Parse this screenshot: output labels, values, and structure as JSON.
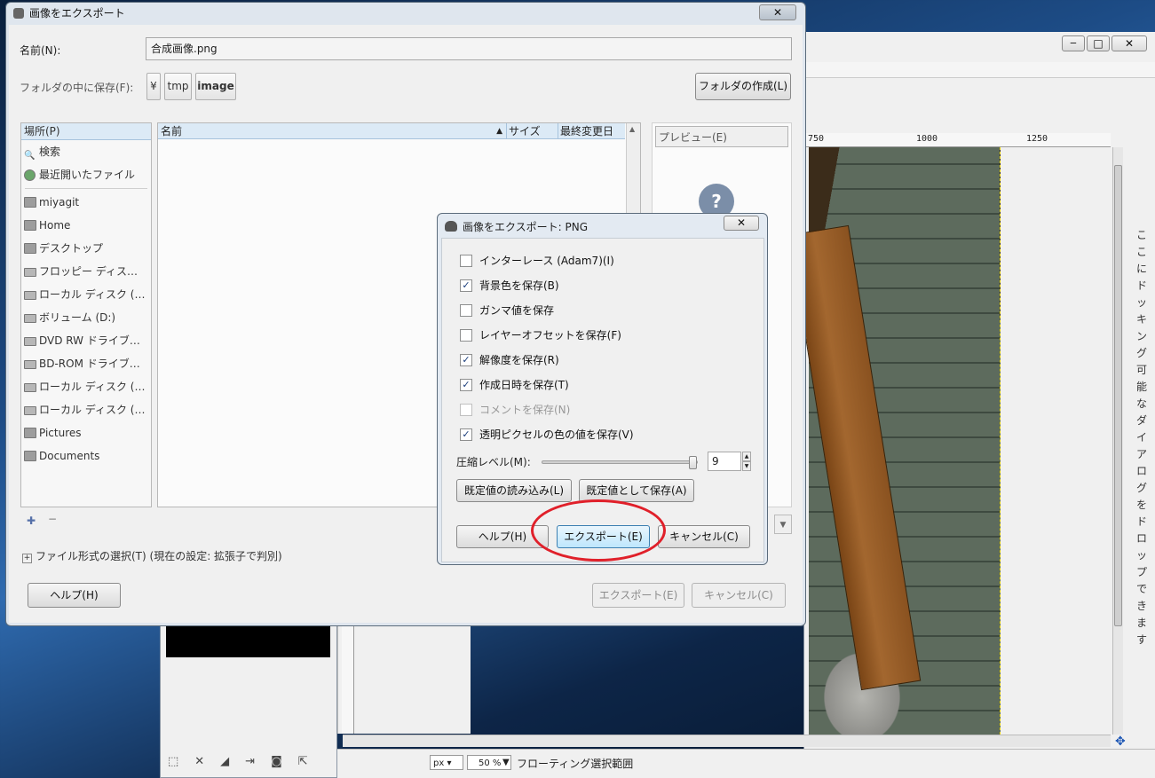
{
  "export_dialog": {
    "title": "画像をエクスポート",
    "name_label": "名前(N):",
    "name_value": "合成画像.png",
    "folder_label": "フォルダの中に保存(F):",
    "path_segments": [
      "¥",
      "tmp",
      "image"
    ],
    "create_folder_label": "フォルダの作成(L)",
    "places_header": "場所(P)",
    "places": [
      {
        "label": "検索",
        "icon": "search-icon"
      },
      {
        "label": "最近開いたファイル",
        "icon": "recent-icon"
      },
      {
        "label": "miyagit",
        "icon": "folder-icon"
      },
      {
        "label": "Home",
        "icon": "folder-icon"
      },
      {
        "label": "デスクトップ",
        "icon": "folder-icon"
      },
      {
        "label": "フロッピー ディス…",
        "icon": "drive-icon"
      },
      {
        "label": "ローカル ディスク (…",
        "icon": "drive-icon"
      },
      {
        "label": "ボリューム (D:)",
        "icon": "drive-icon"
      },
      {
        "label": "DVD RW ドライブ…",
        "icon": "drive-icon"
      },
      {
        "label": "BD-ROM ドライブ…",
        "icon": "drive-icon"
      },
      {
        "label": "ローカル ディスク (…",
        "icon": "drive-icon"
      },
      {
        "label": "ローカル ディスク (…",
        "icon": "drive-icon"
      },
      {
        "label": "Pictures",
        "icon": "folder-icon"
      },
      {
        "label": "Documents",
        "icon": "folder-icon"
      }
    ],
    "columns": {
      "name": "名前",
      "size": "サイズ",
      "modified": "最終変更日"
    },
    "preview_label": "プレビュー(E)",
    "file_type_label": "ファイル形式の選択(T) (現在の設定: 拡張子で判別)",
    "help_label": "ヘルプ(H)",
    "export_label": "エクスポート(E)",
    "cancel_label": "キャンセル(C)"
  },
  "png_dialog": {
    "title": "画像をエクスポート: PNG",
    "options": [
      {
        "label": "インターレース (Adam7)(I)",
        "checked": false,
        "enabled": true
      },
      {
        "label": "背景色を保存(B)",
        "checked": true,
        "enabled": true
      },
      {
        "label": "ガンマ値を保存",
        "checked": false,
        "enabled": true
      },
      {
        "label": "レイヤーオフセットを保存(F)",
        "checked": false,
        "enabled": true
      },
      {
        "label": "解像度を保存(R)",
        "checked": true,
        "enabled": true
      },
      {
        "label": "作成日時を保存(T)",
        "checked": true,
        "enabled": true
      },
      {
        "label": "コメントを保存(N)",
        "checked": false,
        "enabled": false
      },
      {
        "label": "透明ピクセルの色の値を保存(V)",
        "checked": true,
        "enabled": true
      }
    ],
    "compression_label": "圧縮レベル(M):",
    "compression_value": "9",
    "compression_fraction": 1.0,
    "load_defaults_label": "既定値の読み込み(L)",
    "save_defaults_label": "既定値として保存(A)",
    "help_label": "ヘルプ(H)",
    "export_label": "エクスポート(E)",
    "cancel_label": "キャンセル(C)",
    "highlight_color": "#e0202a"
  },
  "gimp_window": {
    "ruler_ticks": [
      "750",
      "1000",
      "1250"
    ],
    "dock_hint": "ここにドッキング可能なダイアログをドロップできます",
    "unit": "px",
    "zoom": "50 %",
    "status": "フローティング選択範囲"
  }
}
